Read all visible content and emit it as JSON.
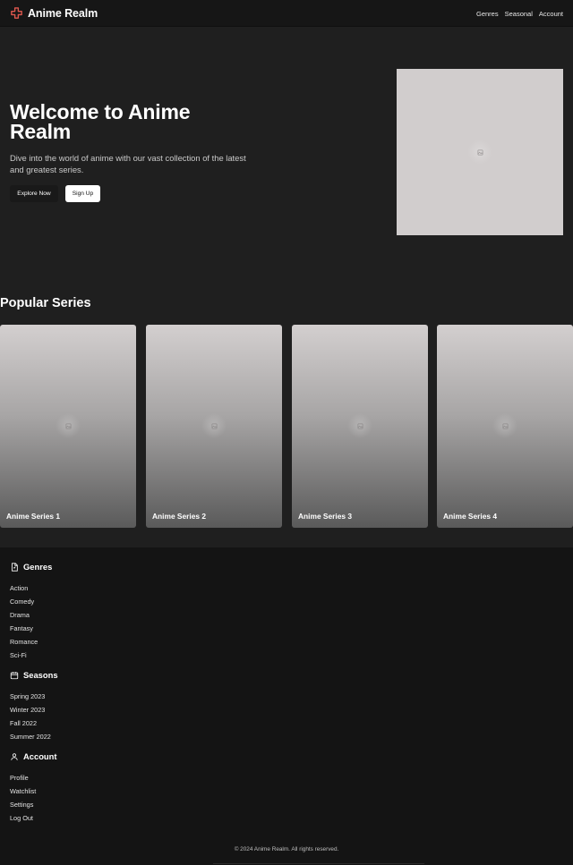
{
  "header": {
    "brand": "Anime Realm",
    "nav": [
      "Genres",
      "Seasonal",
      "Account"
    ],
    "accent": "#e0584f"
  },
  "hero": {
    "title": "Welcome to Anime Realm",
    "description": "Dive into the world of anime with our vast collection of the latest and greatest series.",
    "explore_label": "Explore Now",
    "signup_label": "Sign Up"
  },
  "popular": {
    "title": "Popular Series",
    "items": [
      "Anime Series 1",
      "Anime Series 2",
      "Anime Series 3",
      "Anime Series 4"
    ]
  },
  "footer": {
    "genres": {
      "title": "Genres",
      "items": [
        "Action",
        "Comedy",
        "Drama",
        "Fantasy",
        "Romance",
        "Sci-Fi"
      ]
    },
    "seasons": {
      "title": "Seasons",
      "items": [
        "Spring 2023",
        "Winter 2023",
        "Fall 2022",
        "Summer 2022"
      ]
    },
    "account": {
      "title": "Account",
      "items": [
        "Profile",
        "Watchlist",
        "Settings",
        "Log Out"
      ]
    },
    "copyright": "© 2024 Anime Realm. All rights reserved."
  },
  "colors": {
    "background": "#1f1f1f",
    "topbar": "#161616",
    "footer": "#141414",
    "placeholder": "#d1cdcd"
  }
}
